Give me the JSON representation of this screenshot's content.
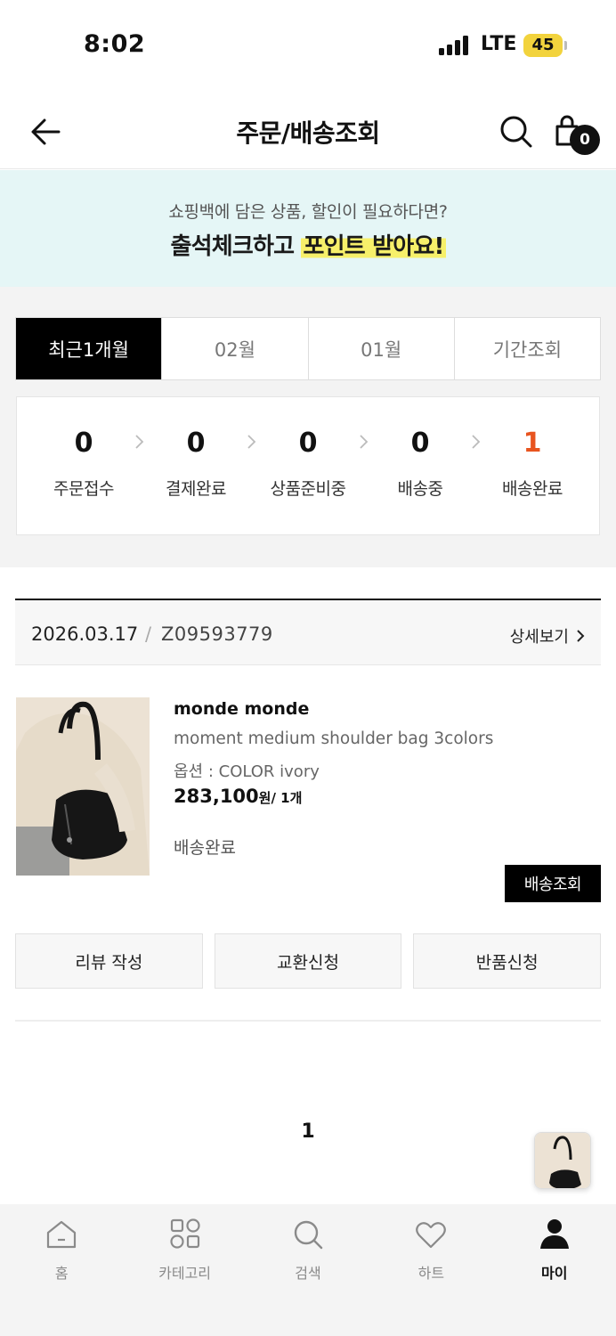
{
  "status_bar": {
    "time": "8:02",
    "network": "LTE",
    "battery": "45"
  },
  "header": {
    "title": "주문/배송조회",
    "cart_count": "0"
  },
  "banner": {
    "subtitle": "쇼핑백에 담은 상품, 할인이 필요하다면?",
    "headline_prefix": "출석체크하고 ",
    "headline_highlight": "포인트 받아요!"
  },
  "period_tabs": [
    {
      "label": "최근1개월",
      "active": true
    },
    {
      "label": "02월",
      "active": false
    },
    {
      "label": "01월",
      "active": false
    },
    {
      "label": "기간조회",
      "active": false
    }
  ],
  "order_status": [
    {
      "count": "0",
      "label": "주문접수"
    },
    {
      "count": "0",
      "label": "결제완료"
    },
    {
      "count": "0",
      "label": "상품준비중"
    },
    {
      "count": "0",
      "label": "배송중"
    },
    {
      "count": "1",
      "label": "배송완료",
      "highlight_color": "#e8541f"
    }
  ],
  "order": {
    "date": "2026.03.17",
    "separator": "/",
    "order_number": "Z09593779",
    "detail_label": "상세보기",
    "item": {
      "brand": "monde monde",
      "name": "moment medium shoulder bag 3colors",
      "option": "옵션 : COLOR ivory",
      "price": "283,100",
      "price_unit": "원/ 1개",
      "status": "배송완료",
      "track_label": "배송조회"
    },
    "actions": [
      "리뷰 작성",
      "교환신청",
      "반품신청"
    ]
  },
  "pagination": {
    "current": "1"
  },
  "tab_bar": [
    {
      "label": "홈",
      "icon": "home-icon",
      "active": false
    },
    {
      "label": "카테고리",
      "icon": "category-icon",
      "active": false
    },
    {
      "label": "검색",
      "icon": "search-icon",
      "active": false
    },
    {
      "label": "하트",
      "icon": "heart-icon",
      "active": false
    },
    {
      "label": "마이",
      "icon": "person-icon",
      "active": true
    }
  ],
  "colors": {
    "accent_orange": "#e8541f",
    "banner_bg": "#e5f6f6",
    "highlight_yellow": "#f7f06a"
  }
}
